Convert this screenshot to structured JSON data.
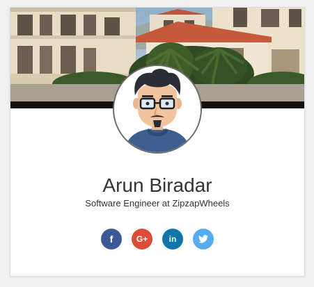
{
  "profile": {
    "name": "Arun Biradar",
    "title": "Software Engineer at ZipzapWheels"
  },
  "social": [
    {
      "name": "facebook",
      "glyph": "f",
      "color": "#3b5998"
    },
    {
      "name": "google-plus",
      "glyph": "G+",
      "color": "#dd4b39"
    },
    {
      "name": "linkedin",
      "glyph": "in",
      "color": "#0e76a8"
    },
    {
      "name": "twitter",
      "glyph": "🐦",
      "color": "#55acee"
    }
  ],
  "colors": {
    "background": "#f0f0f0",
    "card": "#ffffff"
  }
}
